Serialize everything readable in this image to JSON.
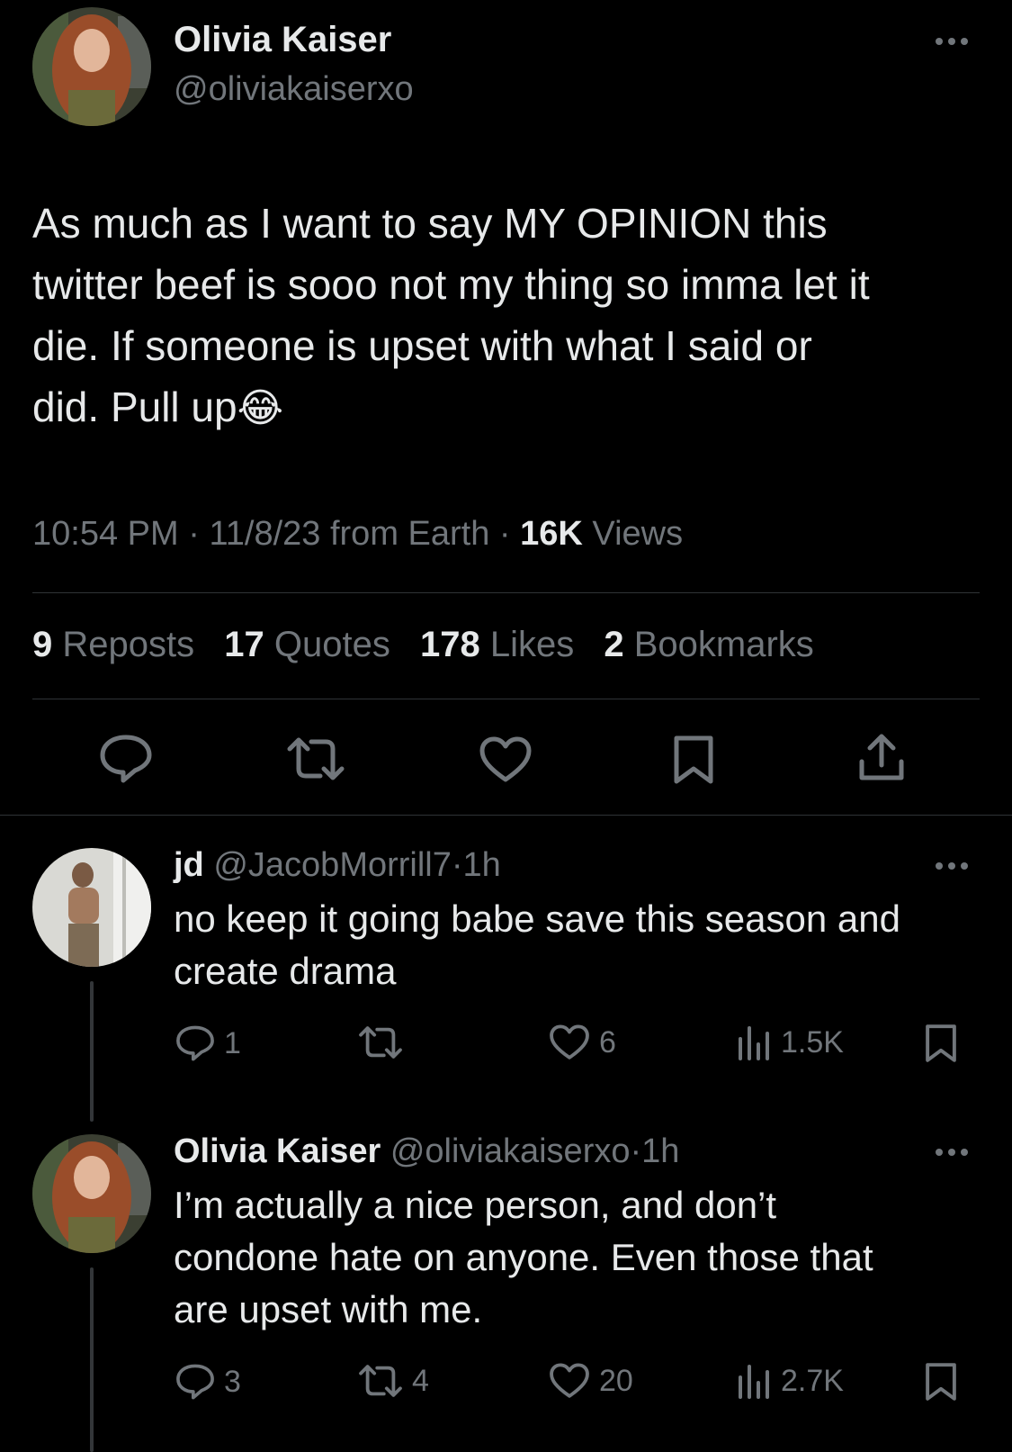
{
  "main_tweet": {
    "display_name": "Olivia Kaiser",
    "handle": "@oliviakaiserxo",
    "text_lines": [
      "As much as I want to say MY OPINION this",
      "twitter beef is sooo not my thing so imma let it",
      "die. If someone is upset with what I said or",
      "did. Pull up"
    ],
    "emoji": "😂",
    "time": "10:54 PM",
    "date": "11/8/23",
    "source": "from Earth",
    "views_count": "16K",
    "views_label": "Views",
    "reposts_count": "9",
    "reposts_label": "Reposts",
    "quotes_count": "17",
    "quotes_label": "Quotes",
    "likes_count": "178",
    "likes_label": "Likes",
    "bookmarks_count": "2",
    "bookmarks_label": "Bookmarks",
    "separator": "·"
  },
  "replies": [
    {
      "display_name": "jd",
      "handle": "@JacobMorrill7",
      "age": "1h",
      "text_lines": [
        "no keep it going babe save this season and",
        "create drama"
      ],
      "reply_count": "1",
      "repost_count": "",
      "like_count": "6",
      "view_count": "1.5K"
    },
    {
      "display_name": "Olivia Kaiser",
      "handle": "@oliviakaiserxo",
      "age": "1h",
      "text_lines": [
        "I’m actually a nice person, and don’t",
        "condone hate on anyone. Even those that",
        "are upset with me."
      ],
      "reply_count": "3",
      "repost_count": "4",
      "like_count": "20",
      "view_count": "2.7K"
    }
  ],
  "colors": {
    "background": "#000000",
    "text": "#e7e9ea",
    "muted": "#71767b",
    "divider": "#2f3336"
  }
}
